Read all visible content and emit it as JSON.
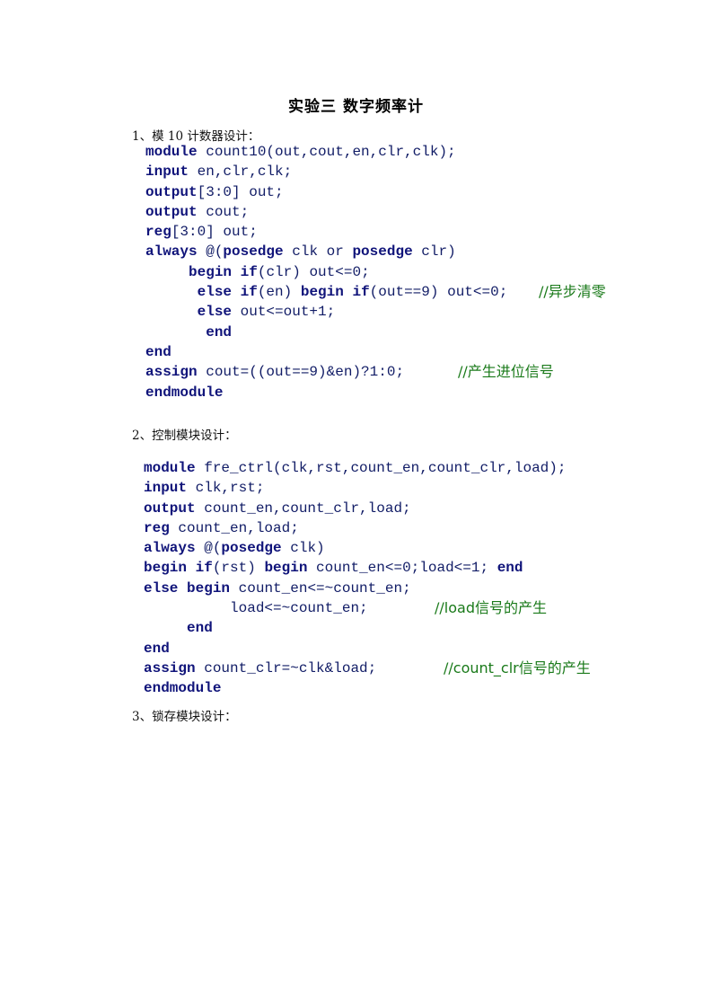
{
  "page": {
    "title": "实验三  数字频率计"
  },
  "sections": [
    {
      "heading": "1、模 10 计数器设计：",
      "code": [
        {
          "text": "module count10(out,cout,en,clr,clk);",
          "comment": ""
        },
        {
          "text": "input en,clr,clk;",
          "comment": ""
        },
        {
          "text": "output[3:0] out;",
          "comment": ""
        },
        {
          "text": "output cout;",
          "comment": ""
        },
        {
          "text": "reg[3:0] out;",
          "comment": ""
        },
        {
          "text": "always @(posedge clk or posedge clr)",
          "comment": ""
        },
        {
          "text": "     begin if(clr) out<=0;",
          "comment": ""
        },
        {
          "text": "      else if(en) begin if(out==9) out<=0;",
          "comment": "//异步清零"
        },
        {
          "text": "      else out<=out+1;",
          "comment": ""
        },
        {
          "text": "       end",
          "comment": ""
        },
        {
          "text": "end",
          "comment": ""
        },
        {
          "text": "assign cout=((out==9)&en)?1:0;",
          "comment": "//产生进位信号"
        },
        {
          "text": "endmodule",
          "comment": ""
        }
      ]
    },
    {
      "heading": "2、控制模块设计：",
      "code": [
        {
          "text": "module fre_ctrl(clk,rst,count_en,count_clr,load);",
          "comment": ""
        },
        {
          "text": "input clk,rst;",
          "comment": ""
        },
        {
          "text": "output count_en,count_clr,load;",
          "comment": ""
        },
        {
          "text": "reg count_en,load;",
          "comment": ""
        },
        {
          "text": "always @(posedge clk)",
          "comment": ""
        },
        {
          "text": "begin if(rst) begin count_en<=0;load<=1; end",
          "comment": ""
        },
        {
          "text": "else begin count_en<=~count_en;",
          "comment": ""
        },
        {
          "text": "          load<=~count_en;",
          "comment": "//load信号的产生"
        },
        {
          "text": "     end",
          "comment": ""
        },
        {
          "text": "end",
          "comment": ""
        },
        {
          "text": "assign count_clr=~clk&load;",
          "comment": "//count_clr信号的产生"
        },
        {
          "text": "endmodule",
          "comment": ""
        }
      ]
    },
    {
      "heading": "3、锁存模块设计：",
      "code": []
    }
  ],
  "colors": {
    "code": "#111c66",
    "keyword": "#10147a",
    "comment": "#1a7a1a"
  }
}
